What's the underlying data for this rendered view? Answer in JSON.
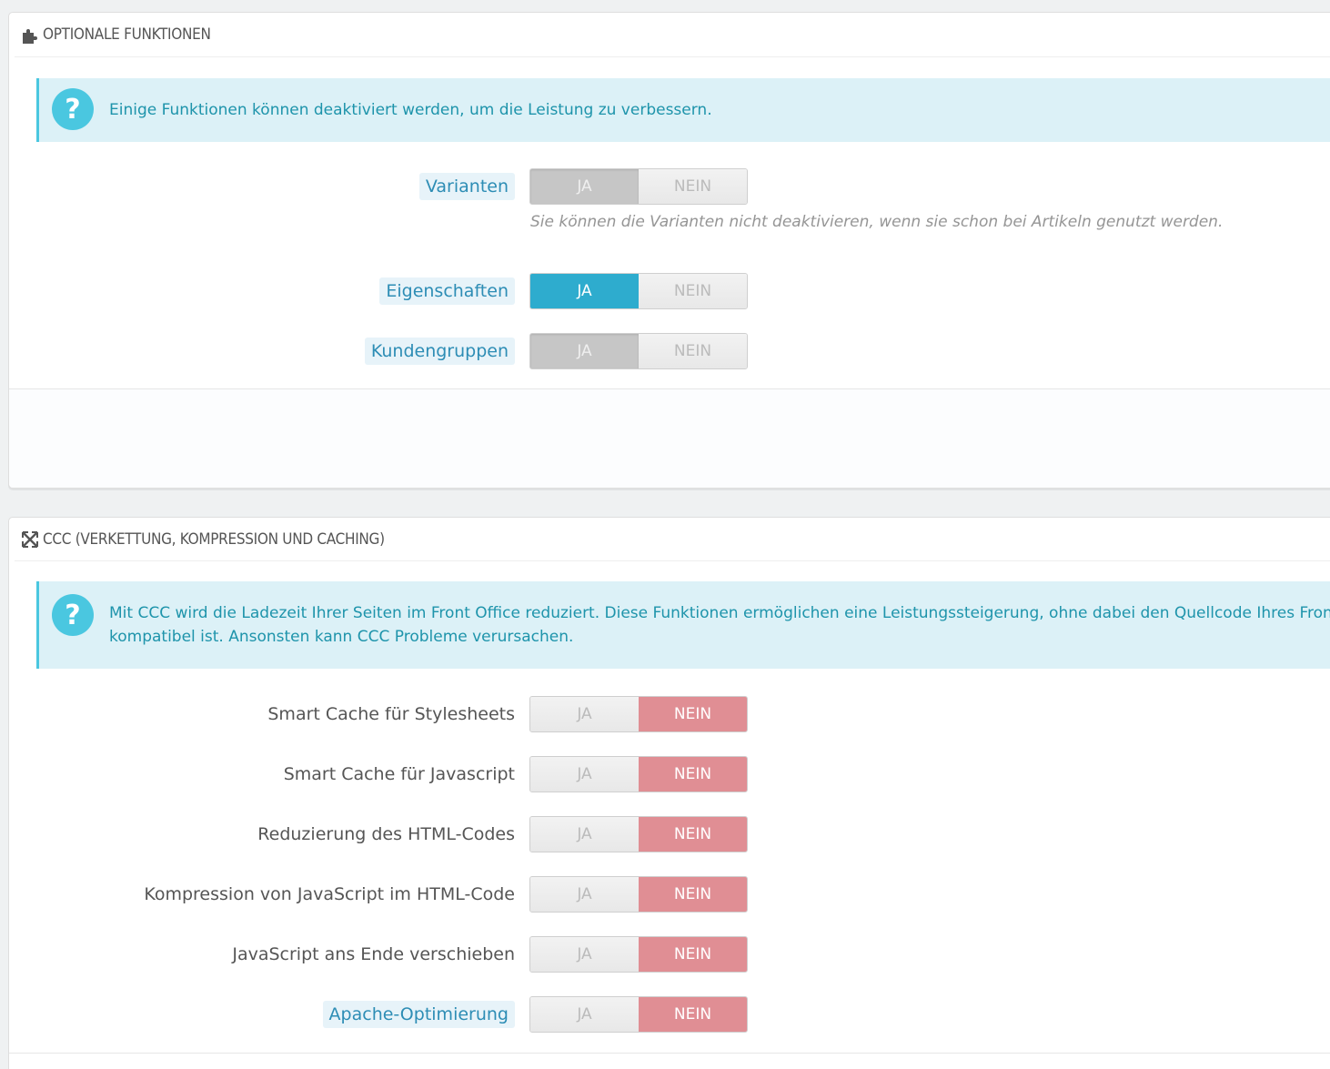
{
  "panel_optional": {
    "title": "OPTIONALE FUNKTIONEN",
    "icon": "puzzle-icon",
    "alert": "Einige Funktionen können deaktiviert werden, um die Leistung zu verbessern.",
    "rows": [
      {
        "label": "Varianten",
        "yes": "JA",
        "no": "NEIN",
        "state": "yes-disabled",
        "help": "Sie können die Varianten nicht deaktivieren, wenn sie schon bei Artikeln genutzt werden."
      },
      {
        "label": "Eigenschaften",
        "yes": "JA",
        "no": "NEIN",
        "state": "yes"
      },
      {
        "label": "Kundengruppen",
        "yes": "JA",
        "no": "NEIN",
        "state": "yes-disabled"
      }
    ]
  },
  "panel_ccc": {
    "title": "CCC (VERKETTUNG, KOMPRESSION UND CACHING)",
    "icon": "arrows-expand-icon",
    "alert_line1": "Mit CCC wird die Ladezeit Ihrer Seiten im Front Office reduziert. Diese Funktionen ermöglichen eine Leistungssteigerung, ohne dabei den Quellcode Ihres Front O",
    "alert_line2": "kompatibel ist. Ansonsten kann CCC Probleme verursachen.",
    "rows": [
      {
        "label": "Smart Cache für Stylesheets",
        "yes": "JA",
        "no": "NEIN",
        "state": "no"
      },
      {
        "label": "Smart Cache für Javascript",
        "yes": "JA",
        "no": "NEIN",
        "state": "no"
      },
      {
        "label": "Reduzierung des HTML-Codes",
        "yes": "JA",
        "no": "NEIN",
        "state": "no"
      },
      {
        "label": "Kompression von JavaScript im HTML-Code",
        "yes": "JA",
        "no": "NEIN",
        "state": "no"
      },
      {
        "label": "JavaScript ans Ende verschieben",
        "yes": "JA",
        "no": "NEIN",
        "state": "no"
      },
      {
        "label": "Apache-Optimierung",
        "yes": "JA",
        "no": "NEIN",
        "state": "no"
      }
    ]
  },
  "colors": {
    "accent_blue": "#2eacce",
    "no_red": "#e08e94",
    "alert_bg": "#dcf1f7",
    "alert_text": "#1e94ab"
  }
}
